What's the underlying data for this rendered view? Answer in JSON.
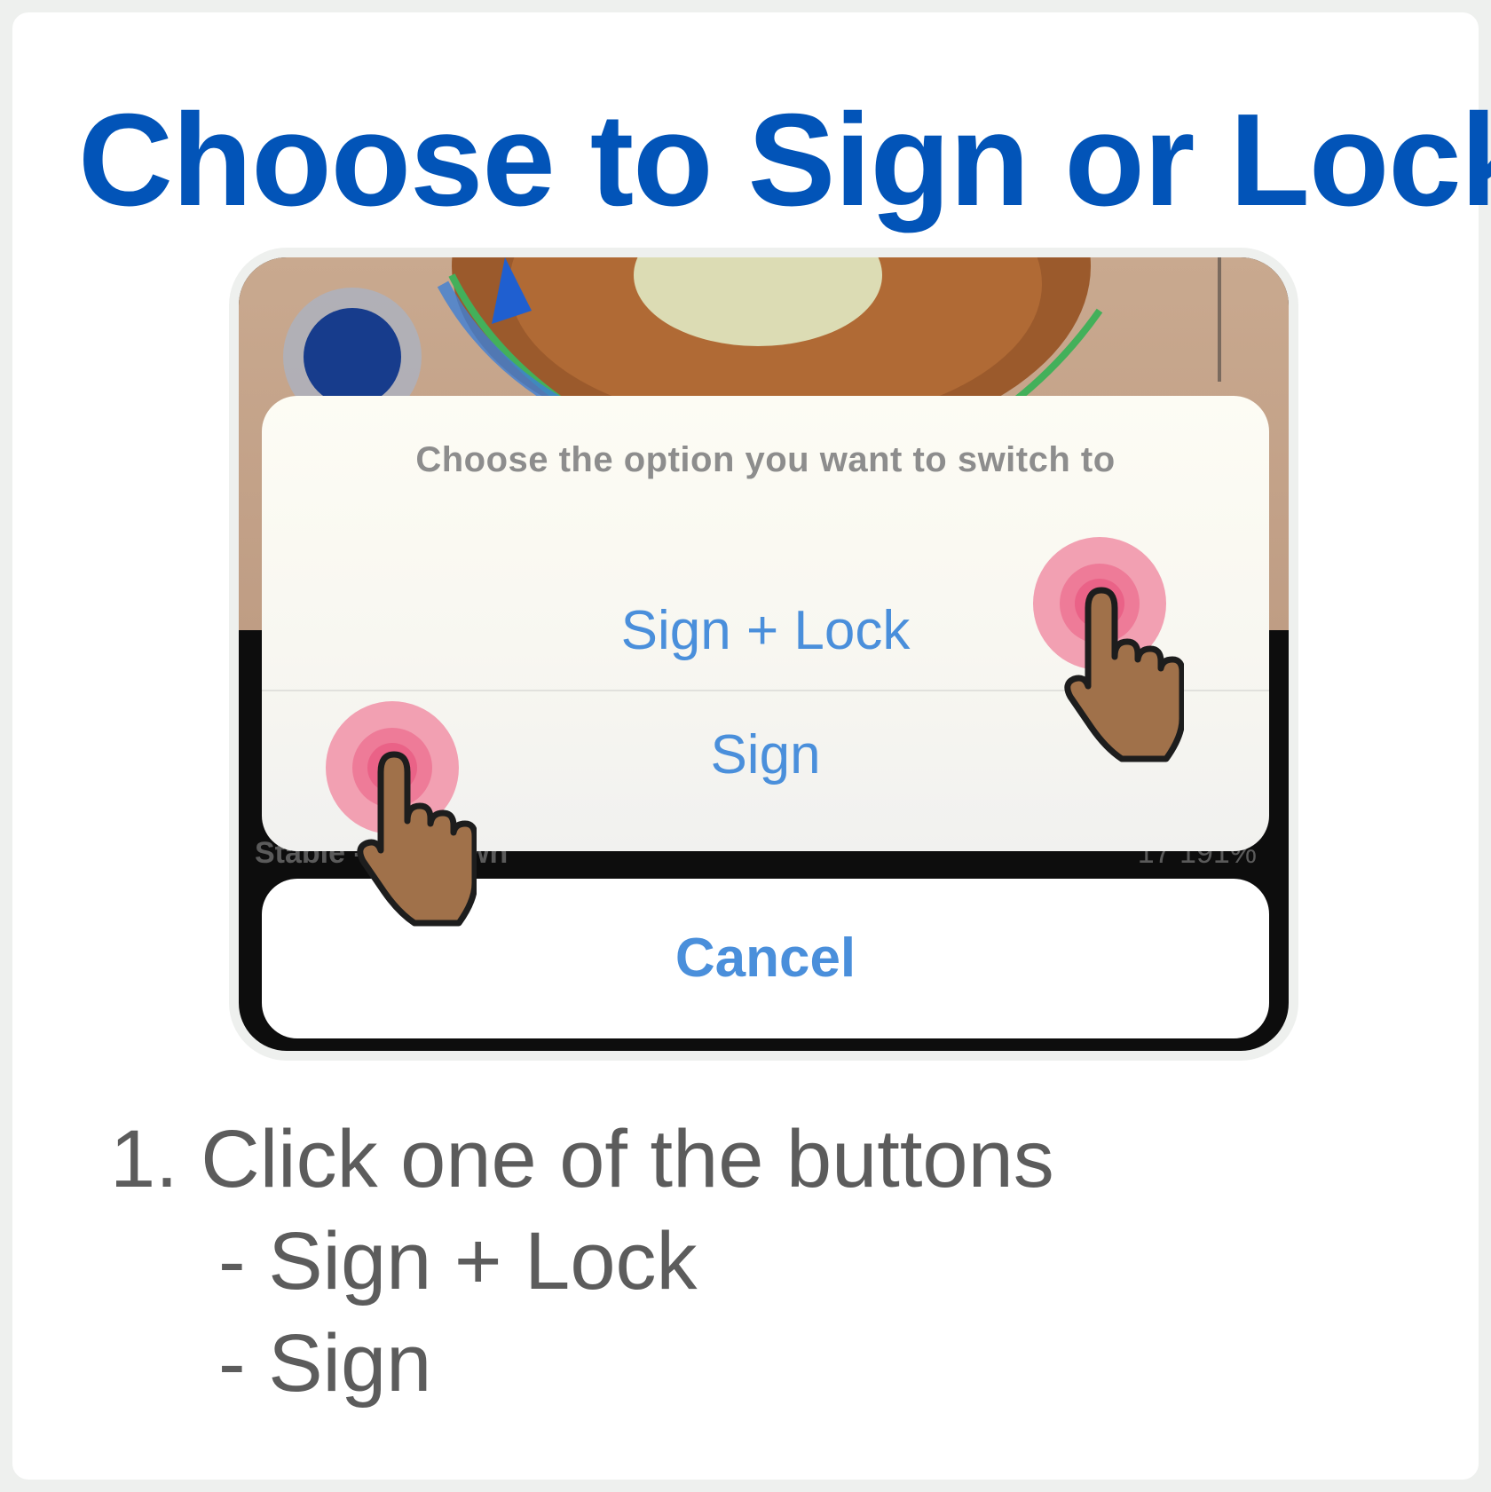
{
  "title": "Choose to Sign or Lock",
  "screenshot": {
    "background_text_left": "Stable - Unknown",
    "background_text_right": "17      191%",
    "action_sheet": {
      "prompt": "Choose the option you want to switch to",
      "options": [
        "Sign + Lock",
        "Sign"
      ],
      "cancel": "Cancel"
    }
  },
  "instructions": {
    "step": "1. Click one of the buttons",
    "choices": [
      "- Sign + Lock",
      "- Sign"
    ]
  },
  "colors": {
    "title": "#0254b8",
    "option_text": "#4a8fdb",
    "tap_ring": "#f2a0b2",
    "hand": "#a0714a"
  },
  "icons": [
    "pointing-hand-icon",
    "tap-indicator-icon"
  ]
}
